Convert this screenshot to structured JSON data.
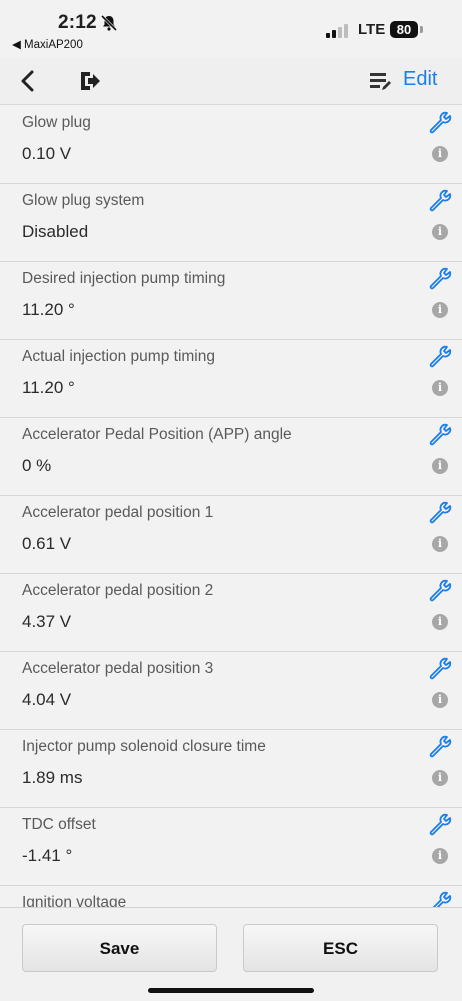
{
  "status_bar": {
    "time": "2:12",
    "back_app": "◀ MaxiAP200",
    "network": "LTE",
    "battery": "80"
  },
  "toolbar": {
    "edit_label": "Edit"
  },
  "colors": {
    "accent": "#1a7ef0",
    "info_icon": "#a7a7a7"
  },
  "rows": [
    {
      "name": "Glow plug",
      "value": "0.10 V"
    },
    {
      "name": "Glow plug system",
      "value": "Disabled"
    },
    {
      "name": "Desired injection pump timing",
      "value": "11.20 °"
    },
    {
      "name": "Actual injection pump timing",
      "value": "11.20 °"
    },
    {
      "name": "Accelerator Pedal Position (APP) angle",
      "value": "0 %"
    },
    {
      "name": "Accelerator pedal position 1",
      "value": "0.61 V"
    },
    {
      "name": "Accelerator pedal position 2",
      "value": "4.37 V"
    },
    {
      "name": "Accelerator pedal position 3",
      "value": "4.04 V"
    },
    {
      "name": "Injector pump solenoid closure time",
      "value": "1.89 ms"
    },
    {
      "name": "TDC offset",
      "value": "-1.41 °"
    },
    {
      "name": "Ignition voltage",
      "value": ""
    }
  ],
  "bottom": {
    "save_label": "Save",
    "esc_label": "ESC"
  }
}
